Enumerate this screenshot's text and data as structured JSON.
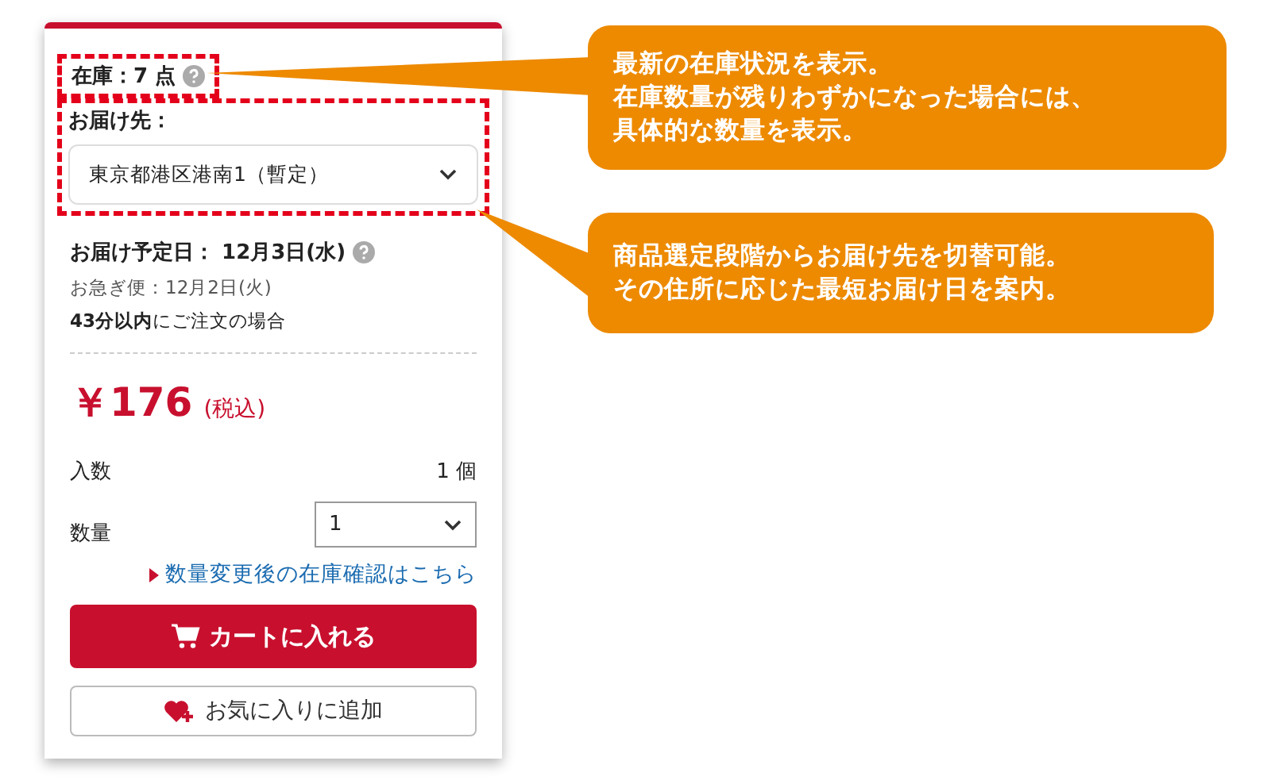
{
  "stock": {
    "label": "在庫：7 点",
    "highlighted": true
  },
  "delivery": {
    "label": "お届け先：",
    "address": "東京都港区港南1（暫定）",
    "highlighted": true
  },
  "schedule": {
    "date": "お届け予定日： 12月3日(水)",
    "express": "お急ぎ便：12月2日(火)",
    "deadline": "**43分以内**にご注文の場合"
  },
  "price": {
    "amount": "￥176",
    "tax": "(税込)"
  },
  "pack": {
    "label": "入数",
    "value": "1 個"
  },
  "quantity": {
    "label": "数量",
    "value": "1"
  },
  "stock_link": "数量変更後の在庫確認はこちら",
  "buttons": [
    {
      "kind": "cart",
      "label": "カートに入れる"
    },
    {
      "kind": "favorite",
      "label": "お気に入りに追加"
    }
  ],
  "callouts": [
    {
      "lines": [
        "最新の在庫状況を表示。",
        "在庫数量が残りわずかになった場合には、",
        "具体的な数量を表示。"
      ]
    },
    {
      "lines": [
        "商品選定段階からお届け先を切替可能。",
        "その住所に応じた最短お届け日を案内。"
      ]
    }
  ]
}
